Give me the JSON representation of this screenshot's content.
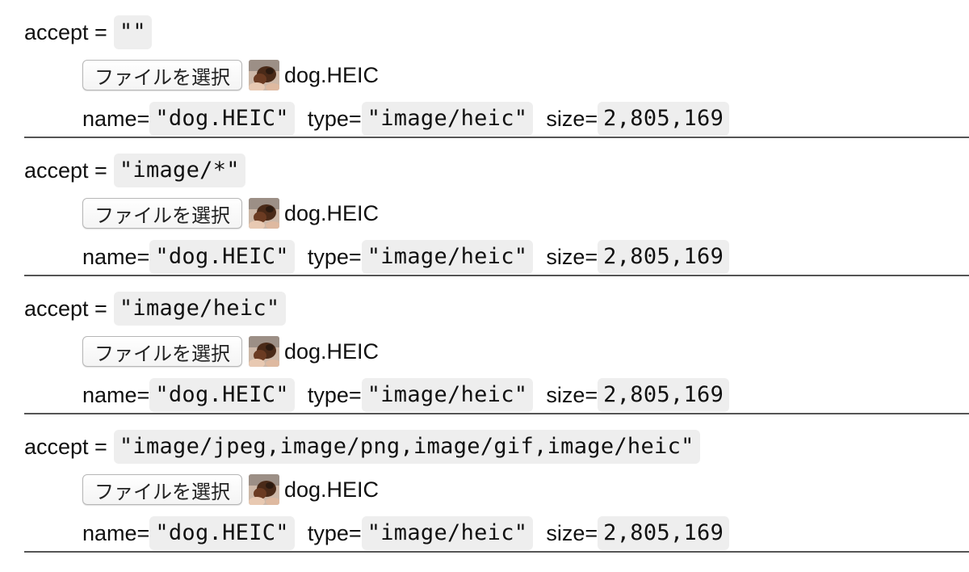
{
  "rows": [
    {
      "accept_label": "accept =",
      "accept_value": "\"\"",
      "button_label": "ファイルを選択",
      "file_name": "dog.HEIC",
      "name_key": "name=",
      "name_value": "\"dog.HEIC\"",
      "type_key": "type=",
      "type_value": "\"image/heic\"",
      "size_key": "size=",
      "size_value": "2,805,169"
    },
    {
      "accept_label": "accept =",
      "accept_value": "\"image/*\"",
      "button_label": "ファイルを選択",
      "file_name": "dog.HEIC",
      "name_key": "name=",
      "name_value": "\"dog.HEIC\"",
      "type_key": "type=",
      "type_value": "\"image/heic\"",
      "size_key": "size=",
      "size_value": "2,805,169"
    },
    {
      "accept_label": "accept =",
      "accept_value": "\"image/heic\"",
      "button_label": "ファイルを選択",
      "file_name": "dog.HEIC",
      "name_key": "name=",
      "name_value": "\"dog.HEIC\"",
      "type_key": "type=",
      "type_value": "\"image/heic\"",
      "size_key": "size=",
      "size_value": "2,805,169"
    },
    {
      "accept_label": "accept =",
      "accept_value": "\"image/jpeg,image/png,image/gif,image/heic\"",
      "button_label": "ファイルを選択",
      "file_name": "dog.HEIC",
      "name_key": "name=",
      "name_value": "\"dog.HEIC\"",
      "type_key": "type=",
      "type_value": "\"image/heic\"",
      "size_key": "size=",
      "size_value": "2,805,169"
    }
  ],
  "thumbnail_icon": "dog-photo-thumbnail",
  "colors": {
    "code_background": "#eeeeee",
    "divider": "#555555",
    "text": "#111111"
  }
}
